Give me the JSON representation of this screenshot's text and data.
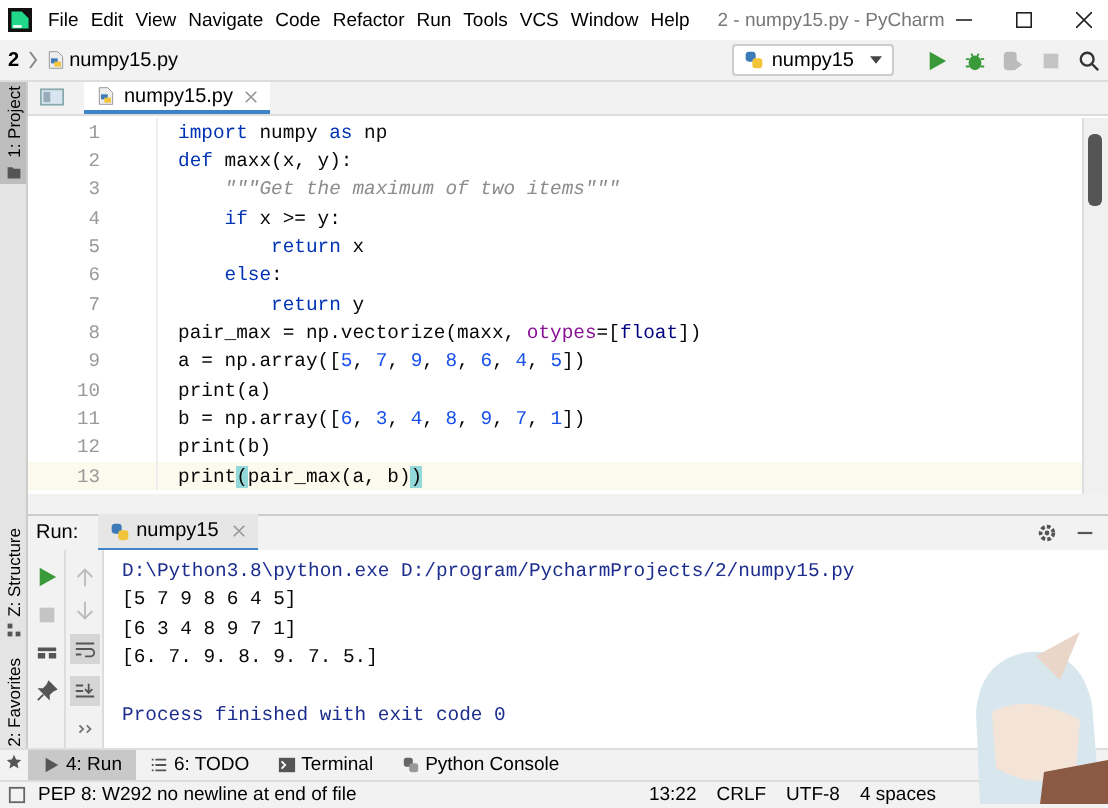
{
  "title_bar": {
    "menu": [
      "File",
      "Edit",
      "View",
      "Navigate",
      "Code",
      "Refactor",
      "Run",
      "Tools",
      "VCS",
      "Window",
      "Help"
    ],
    "title": "2 - numpy15.py - PyCharm"
  },
  "nav_bar": {
    "breadcrumbs": [
      "2",
      "numpy15.py"
    ],
    "run_config": "numpy15"
  },
  "tool_stripe": [
    {
      "label": "1: Project",
      "selected": true
    },
    {
      "label": "Z: Structure",
      "selected": false
    },
    {
      "label": "2: Favorites",
      "selected": false
    }
  ],
  "editor": {
    "tabs": [
      {
        "label": "numpy15.py",
        "selected": true
      }
    ],
    "lines": [
      {
        "number": "1",
        "current": false,
        "tokens": [
          {
            "text": "import",
            "kind": "keyword"
          },
          {
            "text": " numpy ",
            "kind": "plain"
          },
          {
            "text": "as",
            "kind": "keyword"
          },
          {
            "text": " np",
            "kind": "plain"
          }
        ]
      },
      {
        "number": "2",
        "current": false,
        "tokens": [
          {
            "text": "def",
            "kind": "keyword"
          },
          {
            "text": " maxx(x, y):",
            "kind": "plain"
          }
        ]
      },
      {
        "number": "3",
        "current": false,
        "tokens": [
          {
            "text": "    \"\"\"Get the maximum of two items\"\"\"",
            "kind": "doc"
          }
        ]
      },
      {
        "number": "4",
        "current": false,
        "tokens": [
          {
            "text": "    if",
            "kind": "keyword"
          },
          {
            "text": " x >= y:",
            "kind": "plain"
          }
        ]
      },
      {
        "number": "5",
        "current": false,
        "tokens": [
          {
            "text": "        return",
            "kind": "keyword"
          },
          {
            "text": " x",
            "kind": "plain"
          }
        ]
      },
      {
        "number": "6",
        "current": false,
        "tokens": [
          {
            "text": "    else",
            "kind": "keyword"
          },
          {
            "text": ":",
            "kind": "plain"
          }
        ]
      },
      {
        "number": "7",
        "current": false,
        "tokens": [
          {
            "text": "        return",
            "kind": "keyword"
          },
          {
            "text": " y",
            "kind": "plain"
          }
        ]
      },
      {
        "number": "8",
        "current": false,
        "tokens": [
          {
            "text": "pair_max = np.vectorize(maxx, ",
            "kind": "plain"
          },
          {
            "text": "otypes",
            "kind": "param"
          },
          {
            "text": "=[",
            "kind": "plain"
          },
          {
            "text": "float",
            "kind": "builtin"
          },
          {
            "text": "])",
            "kind": "plain"
          }
        ]
      },
      {
        "number": "9",
        "current": false,
        "tokens": [
          {
            "text": "a = np.array([",
            "kind": "plain"
          },
          {
            "text": "5",
            "kind": "number"
          },
          {
            "text": ", ",
            "kind": "plain"
          },
          {
            "text": "7",
            "kind": "number"
          },
          {
            "text": ", ",
            "kind": "plain"
          },
          {
            "text": "9",
            "kind": "number"
          },
          {
            "text": ", ",
            "kind": "plain"
          },
          {
            "text": "8",
            "kind": "number"
          },
          {
            "text": ", ",
            "kind": "plain"
          },
          {
            "text": "6",
            "kind": "number"
          },
          {
            "text": ", ",
            "kind": "plain"
          },
          {
            "text": "4",
            "kind": "number"
          },
          {
            "text": ", ",
            "kind": "plain"
          },
          {
            "text": "5",
            "kind": "number"
          },
          {
            "text": "])",
            "kind": "plain"
          }
        ]
      },
      {
        "number": "10",
        "current": false,
        "tokens": [
          {
            "text": "print(a)",
            "kind": "plain"
          }
        ]
      },
      {
        "number": "11",
        "current": false,
        "tokens": [
          {
            "text": "b = np.array([",
            "kind": "plain"
          },
          {
            "text": "6",
            "kind": "number"
          },
          {
            "text": ", ",
            "kind": "plain"
          },
          {
            "text": "3",
            "kind": "number"
          },
          {
            "text": ", ",
            "kind": "plain"
          },
          {
            "text": "4",
            "kind": "number"
          },
          {
            "text": ", ",
            "kind": "plain"
          },
          {
            "text": "8",
            "kind": "number"
          },
          {
            "text": ", ",
            "kind": "plain"
          },
          {
            "text": "9",
            "kind": "number"
          },
          {
            "text": ", ",
            "kind": "plain"
          },
          {
            "text": "7",
            "kind": "number"
          },
          {
            "text": ", ",
            "kind": "plain"
          },
          {
            "text": "1",
            "kind": "number"
          },
          {
            "text": "])",
            "kind": "plain"
          }
        ]
      },
      {
        "number": "12",
        "current": false,
        "tokens": [
          {
            "text": "print(b)",
            "kind": "plain"
          }
        ]
      },
      {
        "number": "13",
        "current": true,
        "tokens": [
          {
            "text": "print",
            "kind": "plain"
          },
          {
            "text": "(",
            "kind": "brace-match"
          },
          {
            "text": "pair_max(a, b)",
            "kind": "plain"
          },
          {
            "text": ")",
            "kind": "brace-match"
          }
        ]
      }
    ]
  },
  "run_panel": {
    "label": "Run:",
    "tabs": [
      {
        "label": "numpy15",
        "selected": true
      }
    ],
    "output": [
      {
        "text": "D:\\Python3.8\\python.exe D:/program/PycharmProjects/2/numpy15.py",
        "kind": "command"
      },
      {
        "text": "[5 7 9 8 6 4 5]",
        "kind": "stdout"
      },
      {
        "text": "[6 3 4 8 9 7 1]",
        "kind": "stdout"
      },
      {
        "text": "[6. 7. 9. 8. 9. 7. 5.]",
        "kind": "stdout"
      },
      {
        "text": "Process finished with exit code 0",
        "kind": "exit"
      }
    ]
  },
  "bottom_tools": [
    {
      "label": "4: Run",
      "selected": true
    },
    {
      "label": "6: TODO",
      "selected": false
    },
    {
      "label": "Terminal",
      "selected": false
    },
    {
      "label": "Python Console",
      "selected": false
    }
  ],
  "status_bar": {
    "message": "PEP 8: W292 no newline at end of file",
    "items": [
      "13:22",
      "CRLF",
      "UTF-8",
      "4 spaces"
    ]
  }
}
